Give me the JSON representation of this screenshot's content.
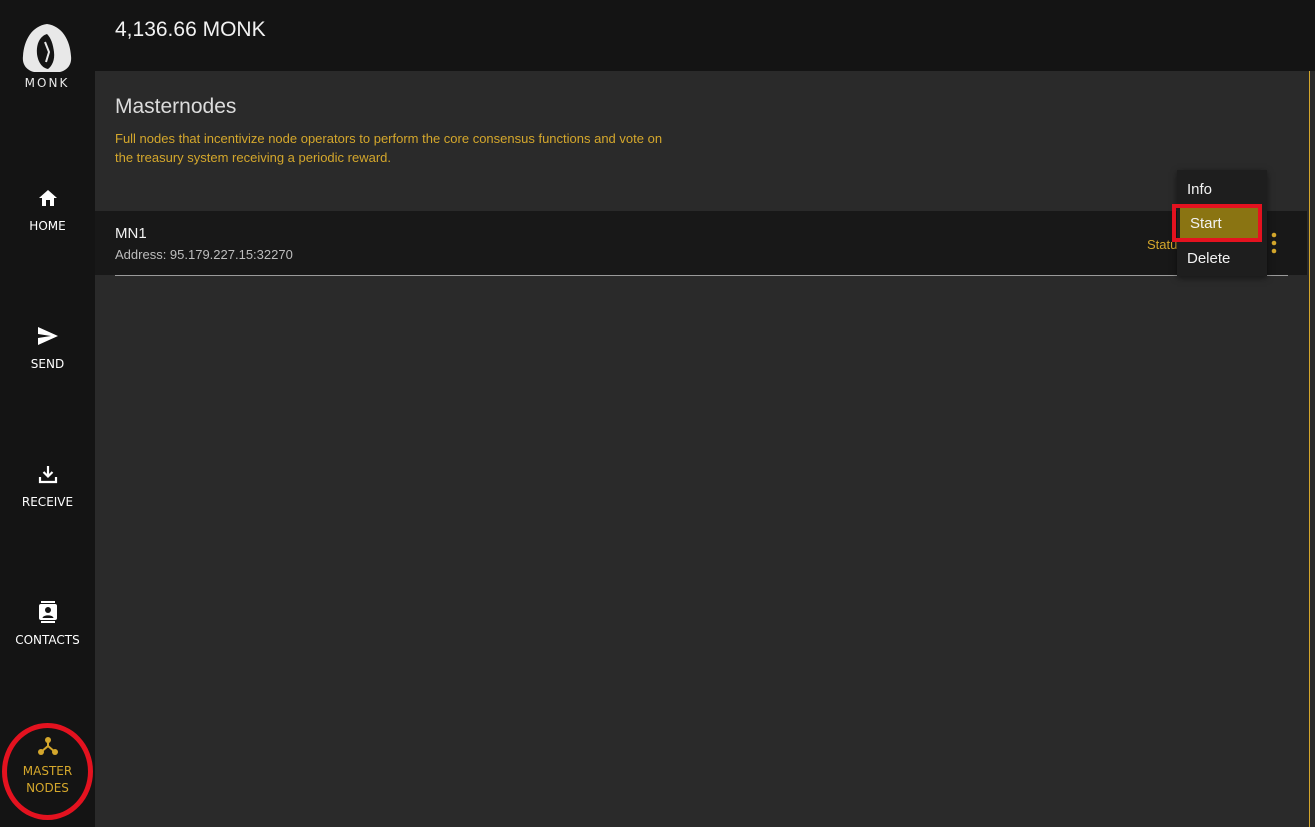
{
  "app": {
    "logo_text": "MONK"
  },
  "colors": {
    "accent": "#d4a72c",
    "highlight": "#e4121f",
    "sidebar_bg": "#141414",
    "main_bg": "#2a2a2a",
    "menu_selected_bg": "#8a7412"
  },
  "header": {
    "balance": "4,136.66 MONK"
  },
  "sidebar": {
    "items": [
      {
        "label": "HOME",
        "icon": "home-icon"
      },
      {
        "label": "SEND",
        "icon": "send-icon"
      },
      {
        "label": "RECEIVE",
        "icon": "download-icon"
      },
      {
        "label": "CONTACTS",
        "icon": "contacts-icon"
      },
      {
        "label": "MASTER NODES",
        "icon": "masternodes-icon",
        "active": true
      }
    ]
  },
  "page": {
    "title": "Masternodes",
    "description": "Full nodes that incentivize node operators to perform the core consensus functions and vote on the treasury system receiving a periodic reward."
  },
  "masternodes": [
    {
      "name": "MN1",
      "address": "Address: 95.179.227.15:32270",
      "status": "Statu"
    }
  ],
  "context_menu": {
    "items": [
      {
        "label": "Info"
      },
      {
        "label": "Start",
        "selected": true
      },
      {
        "label": "Delete"
      }
    ]
  }
}
